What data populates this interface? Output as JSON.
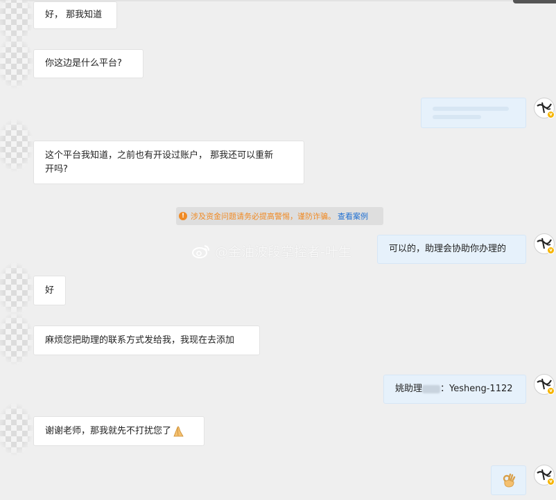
{
  "messages": [
    {
      "side": "in",
      "text": "好， 那我知道"
    },
    {
      "side": "in",
      "text": "你这边是什么平台?"
    },
    {
      "side": "out",
      "text": ""
    },
    {
      "side": "in",
      "text_line1": "这个平台我知道，之前也有开设过账户， 那我还可以重新",
      "text_line2": "开吗?"
    },
    {
      "side": "out",
      "text": "可以的，助理会协助你办理的"
    },
    {
      "side": "in",
      "text": "好"
    },
    {
      "side": "in",
      "text": "麻烦您把助理的联系方式发给我，我现在去添加"
    },
    {
      "side": "out",
      "text_prefix": "姚助理",
      "text_suffix": "：Yesheng-1122"
    },
    {
      "side": "in",
      "text": "谢谢老师，那我就先不打扰您了",
      "emoji": "pray-hands-icon"
    },
    {
      "side": "out",
      "emoji": "ok-hand-icon"
    }
  ],
  "notice": {
    "text": "涉及资金问题请务必提高警惕，谨防诈骗。",
    "link": "查看案例",
    "color": "#f08a24",
    "link_color": "#1f6fd1"
  },
  "watermark": {
    "text": "@金油波段掌控者-叶生",
    "icon": "weibo-icon"
  },
  "colors": {
    "background": "#efefef",
    "bubble_in": "#ffffff",
    "bubble_out": "#e6f1fb",
    "avatar_badge": "#f5b400"
  }
}
